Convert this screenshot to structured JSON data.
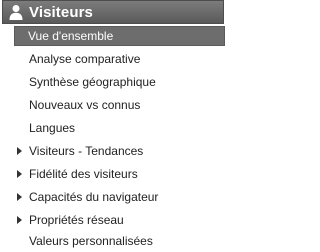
{
  "section": {
    "title": "Visiteurs",
    "icon": "person-icon"
  },
  "menu": {
    "items": [
      {
        "label": "Vue d'ensemble",
        "selected": true,
        "expandable": false
      },
      {
        "label": "Analyse comparative",
        "selected": false,
        "expandable": false
      },
      {
        "label": "Synthèse géographique",
        "selected": false,
        "expandable": false
      },
      {
        "label": "Nouveaux vs connus",
        "selected": false,
        "expandable": false
      },
      {
        "label": "Langues",
        "selected": false,
        "expandable": false
      },
      {
        "label": "Visiteurs - Tendances",
        "selected": false,
        "expandable": true
      },
      {
        "label": "Fidélité des visiteurs",
        "selected": false,
        "expandable": true
      },
      {
        "label": "Capacités du navigateur",
        "selected": false,
        "expandable": true
      },
      {
        "label": "Propriétés réseau",
        "selected": false,
        "expandable": true
      },
      {
        "label": "Valeurs personnalisées",
        "selected": false,
        "expandable": false
      }
    ]
  },
  "colors": {
    "header_bg": "#5a5a5a",
    "selected_bg": "#6d6d6d",
    "text": "#222222"
  }
}
